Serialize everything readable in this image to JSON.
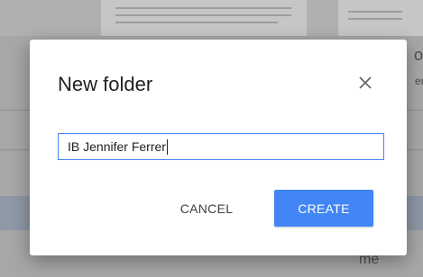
{
  "background": {
    "side_text_1": "o",
    "side_text_2": "er",
    "bottom_text": "me"
  },
  "dialog": {
    "title": "New folder",
    "close_glyph": "✕",
    "folder_name_value": "IB Jennifer Ferrer",
    "cancel_label": "CANCEL",
    "create_label": "CREATE"
  },
  "colors": {
    "accent": "#4285f4",
    "overlay": "#a7a7a7"
  },
  "icons": {
    "close": "close-icon"
  }
}
